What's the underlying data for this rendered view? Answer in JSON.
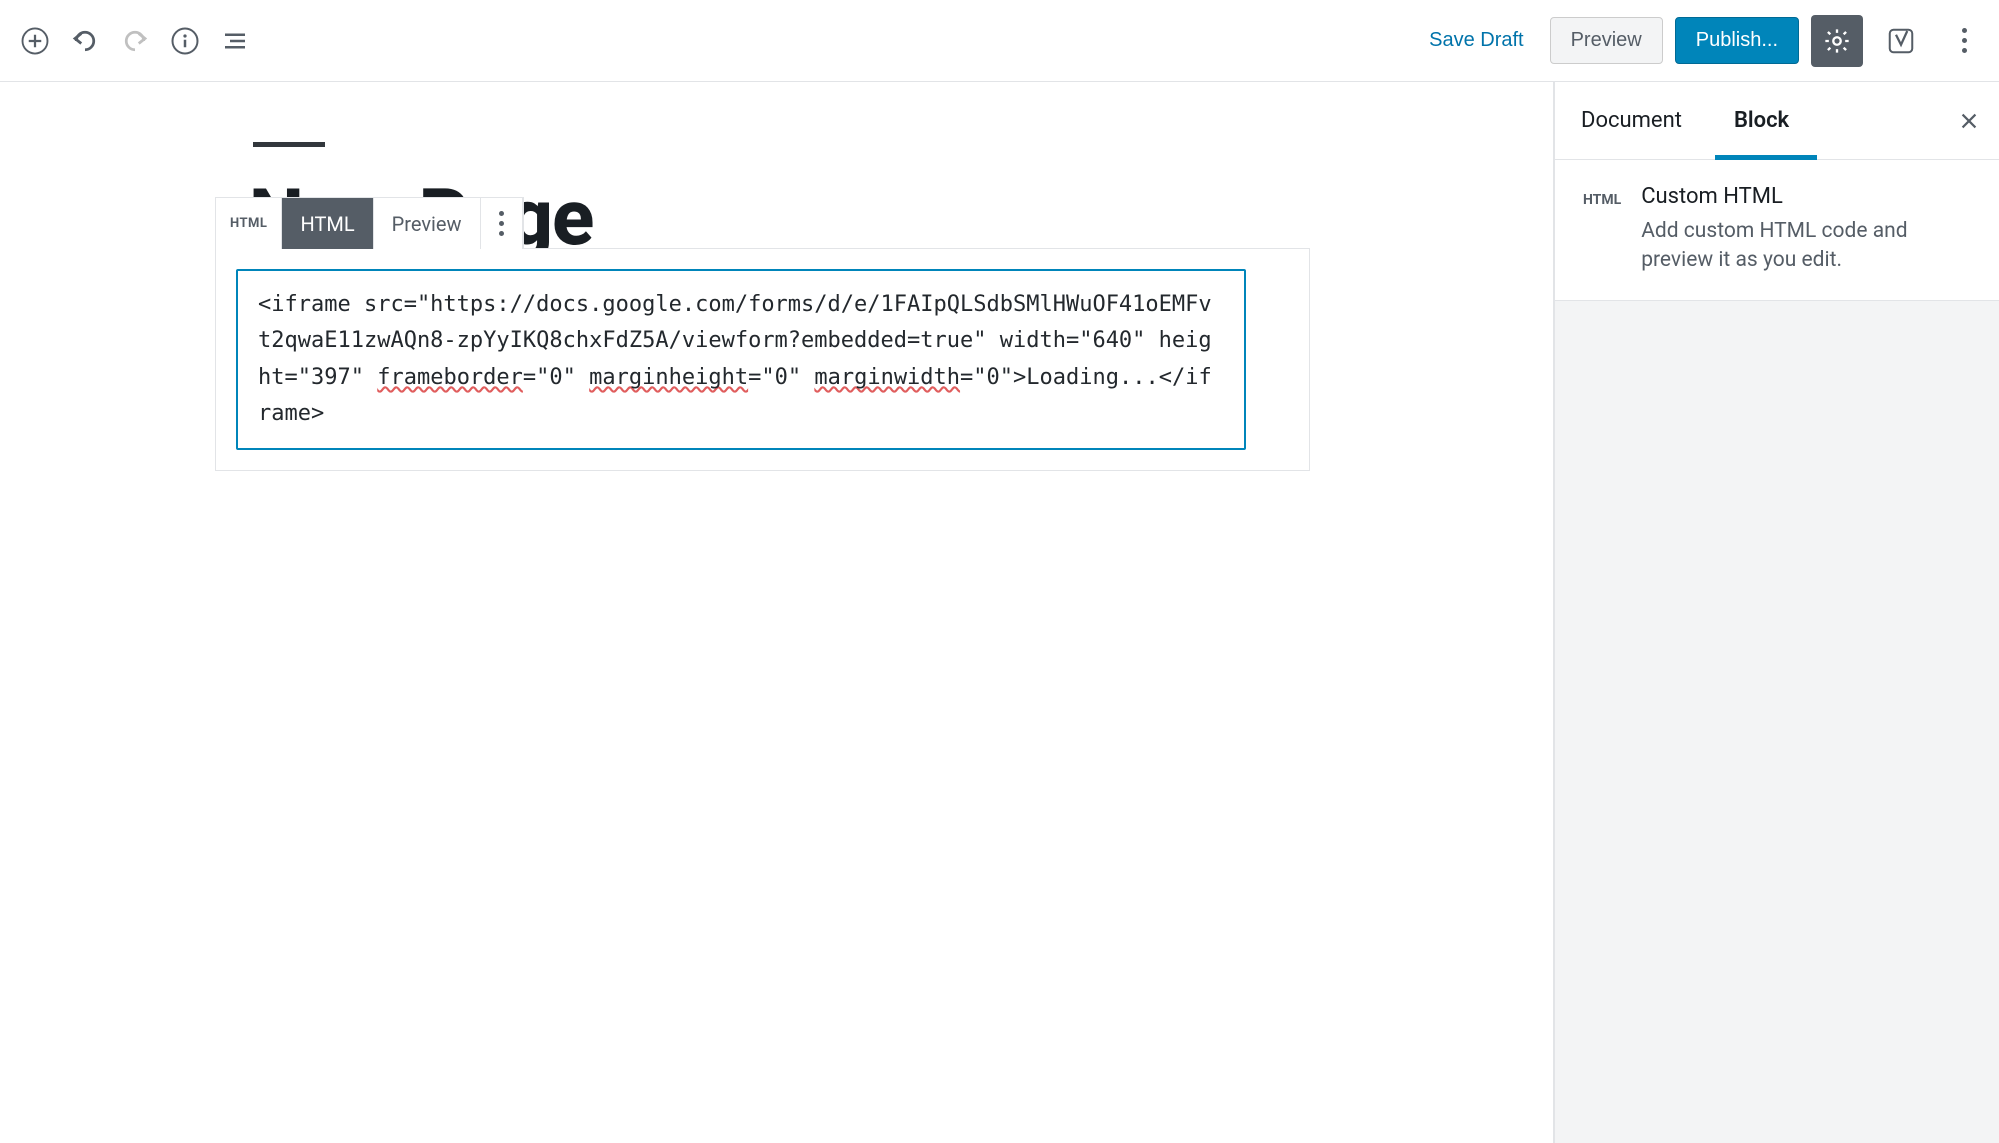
{
  "toolbar": {
    "save_draft": "Save Draft",
    "preview": "Preview",
    "publish": "Publish..."
  },
  "page": {
    "title": "New Page"
  },
  "block_toolbar": {
    "icon_label": "HTML",
    "tab_html": "HTML",
    "tab_preview": "Preview"
  },
  "block": {
    "code_prefix": "<iframe src=\"https://docs.google.com/forms/d/e/1FAIpQLSdbSMlHWuOF41oEMFvt2qwaE11zwAQn8-zpYyIKQ8chxFdZ5A/viewform?embedded=true\" width=\"640\" height=\"397\" ",
    "w_frameborder": "frameborder",
    "seg1": "=\"0\" ",
    "w_marginheight": "marginheight",
    "seg2": "=\"0\" ",
    "w_marginwidth": "marginwidth",
    "seg3": "=\"0\">Loading...</iframe>"
  },
  "sidebar": {
    "tab_document": "Document",
    "tab_block": "Block",
    "panel": {
      "icon_label": "HTML",
      "title": "Custom HTML",
      "description": "Add custom HTML code and preview it as you edit."
    }
  }
}
